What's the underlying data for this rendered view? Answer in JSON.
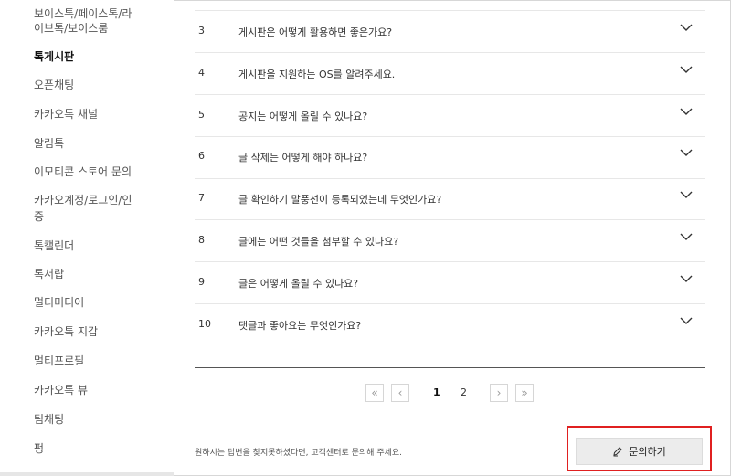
{
  "sidebar": {
    "items": [
      {
        "label": "보이스톡/페이스톡/라"
      },
      {
        "label": "이브톡/보이스룸"
      },
      {
        "label": "톡게시판"
      },
      {
        "label": "오픈채팅"
      },
      {
        "label": "카카오톡 채널"
      },
      {
        "label": "알림톡"
      },
      {
        "label": "이모티콘 스토어 문의"
      },
      {
        "label": "카카오계정/로그인/인"
      },
      {
        "label": "증"
      },
      {
        "label": "톡캘린더"
      },
      {
        "label": "톡서랍"
      },
      {
        "label": "멀티미디어"
      },
      {
        "label": "카카오톡 지갑"
      },
      {
        "label": "멀티프로필"
      },
      {
        "label": "카카오톡 뷰"
      },
      {
        "label": "팀채팅"
      },
      {
        "label": "펑"
      }
    ]
  },
  "faq": {
    "items": [
      {
        "num": "3",
        "question": "게시판은 어떻게 활용하면 좋은가요?"
      },
      {
        "num": "4",
        "question": "게시판을 지원하는 OS를 알려주세요."
      },
      {
        "num": "5",
        "question": "공지는 어떻게 올릴 수 있나요?"
      },
      {
        "num": "6",
        "question": "글 삭제는 어떻게 해야 하나요?"
      },
      {
        "num": "7",
        "question": "글 확인하기 말풍선이 등록되었는데 무엇인가요?"
      },
      {
        "num": "8",
        "question": "글에는 어떤 것들을 첨부할 수 있나요?"
      },
      {
        "num": "9",
        "question": "글은 어떻게 올릴 수 있나요?"
      },
      {
        "num": "10",
        "question": "댓글과 좋아요는 무엇인가요?"
      }
    ]
  },
  "pagination": {
    "first": "«",
    "prev": "‹",
    "pages": [
      "1",
      "2"
    ],
    "current": "1",
    "next": "›",
    "last": "»"
  },
  "footer": {
    "help_text": "원하시는 답변을 찾지못하셨다면, 고객센터로 문의해 주세요.",
    "inquiry_label": "문의하기",
    "inquiry_icon": "pencil-icon"
  },
  "colors": {
    "highlight": "#e02020"
  }
}
